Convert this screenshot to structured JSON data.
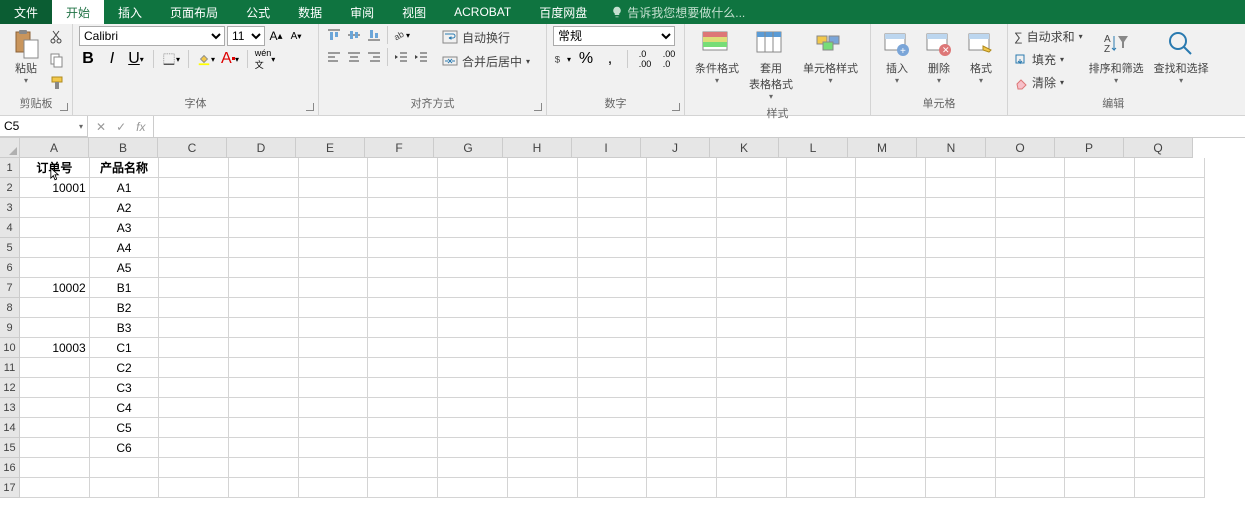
{
  "tabs": {
    "file": "文件",
    "home": "开始",
    "insert": "插入",
    "layout": "页面布局",
    "formulas": "公式",
    "data": "数据",
    "review": "审阅",
    "view": "视图",
    "acrobat": "ACROBAT",
    "baidu": "百度网盘",
    "tellme": "告诉我您想要做什么..."
  },
  "ribbon": {
    "clipboard": {
      "paste": "粘贴",
      "label": "剪贴板"
    },
    "font": {
      "name": "Calibri",
      "size": "11",
      "label": "字体"
    },
    "align": {
      "wrap": "自动换行",
      "merge": "合并后居中",
      "label": "对齐方式"
    },
    "number": {
      "format": "常规",
      "label": "数字"
    },
    "styles": {
      "cond": "条件格式",
      "table": "套用\n表格格式",
      "cell": "单元格样式",
      "label": "样式"
    },
    "cells": {
      "insert": "插入",
      "delete": "删除",
      "format": "格式",
      "label": "单元格"
    },
    "editing": {
      "sum": "自动求和",
      "fill": "填充",
      "clear": "清除",
      "sort": "排序和筛选",
      "find": "查找和选择",
      "label": "编辑"
    }
  },
  "fbar": {
    "name": "C5",
    "fx": "fx"
  },
  "grid": {
    "cols": [
      "A",
      "B",
      "C",
      "D",
      "E",
      "F",
      "G",
      "H",
      "I",
      "J",
      "K",
      "L",
      "M",
      "N",
      "O",
      "P",
      "Q"
    ],
    "rows": [
      "1",
      "2",
      "3",
      "4",
      "5",
      "6",
      "7",
      "8",
      "9",
      "10",
      "11",
      "12",
      "13",
      "14",
      "15",
      "16",
      "17"
    ],
    "headers": {
      "A": "订单号",
      "B": "产品名称"
    },
    "data": [
      {
        "A": "10001",
        "B": "A1"
      },
      {
        "A": "",
        "B": "A2"
      },
      {
        "A": "",
        "B": "A3"
      },
      {
        "A": "",
        "B": "A4"
      },
      {
        "A": "",
        "B": "A5"
      },
      {
        "A": "10002",
        "B": "B1"
      },
      {
        "A": "",
        "B": "B2"
      },
      {
        "A": "",
        "B": "B3"
      },
      {
        "A": "10003",
        "B": "C1"
      },
      {
        "A": "",
        "B": "C2"
      },
      {
        "A": "",
        "B": "C3"
      },
      {
        "A": "",
        "B": "C4"
      },
      {
        "A": "",
        "B": "C5"
      },
      {
        "A": "",
        "B": "C6"
      }
    ]
  }
}
